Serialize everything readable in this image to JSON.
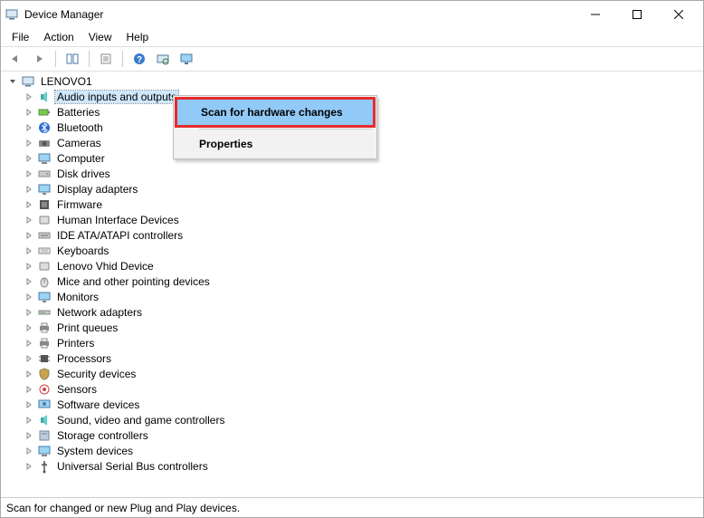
{
  "window": {
    "title": "Device Manager"
  },
  "menu": {
    "items": [
      "File",
      "Action",
      "View",
      "Help"
    ]
  },
  "toolbar": {
    "buttons": [
      {
        "name": "back-icon"
      },
      {
        "name": "forward-icon"
      },
      {
        "name": "show-hide-console-icon"
      },
      {
        "name": "properties-icon"
      },
      {
        "name": "help-icon"
      },
      {
        "name": "scan-hardware-icon"
      },
      {
        "name": "display-icon"
      }
    ]
  },
  "tree": {
    "root": {
      "label": "LENOVO1",
      "expanded": true
    },
    "items": [
      {
        "label": "Audio inputs and outputs",
        "icon": "speaker",
        "selected": true
      },
      {
        "label": "Batteries",
        "icon": "battery"
      },
      {
        "label": "Bluetooth",
        "icon": "bluetooth"
      },
      {
        "label": "Cameras",
        "icon": "camera"
      },
      {
        "label": "Computer",
        "icon": "computer"
      },
      {
        "label": "Disk drives",
        "icon": "disk"
      },
      {
        "label": "Display adapters",
        "icon": "display"
      },
      {
        "label": "Firmware",
        "icon": "firmware"
      },
      {
        "label": "Human Interface Devices",
        "icon": "hid"
      },
      {
        "label": "IDE ATA/ATAPI controllers",
        "icon": "ide"
      },
      {
        "label": "Keyboards",
        "icon": "keyboard"
      },
      {
        "label": "Lenovo Vhid Device",
        "icon": "hid"
      },
      {
        "label": "Mice and other pointing devices",
        "icon": "mouse"
      },
      {
        "label": "Monitors",
        "icon": "monitor"
      },
      {
        "label": "Network adapters",
        "icon": "network"
      },
      {
        "label": "Print queues",
        "icon": "printer"
      },
      {
        "label": "Printers",
        "icon": "printer"
      },
      {
        "label": "Processors",
        "icon": "cpu"
      },
      {
        "label": "Security devices",
        "icon": "security"
      },
      {
        "label": "Sensors",
        "icon": "sensor"
      },
      {
        "label": "Software devices",
        "icon": "software"
      },
      {
        "label": "Sound, video and game controllers",
        "icon": "sound"
      },
      {
        "label": "Storage controllers",
        "icon": "storage"
      },
      {
        "label": "System devices",
        "icon": "system"
      },
      {
        "label": "Universal Serial Bus controllers",
        "icon": "usb"
      }
    ]
  },
  "context_menu": {
    "items": [
      {
        "label": "Scan for hardware changes",
        "highlight": true
      },
      {
        "label": "Properties"
      }
    ]
  },
  "statusbar": {
    "text": "Scan for changed or new Plug and Play devices."
  }
}
